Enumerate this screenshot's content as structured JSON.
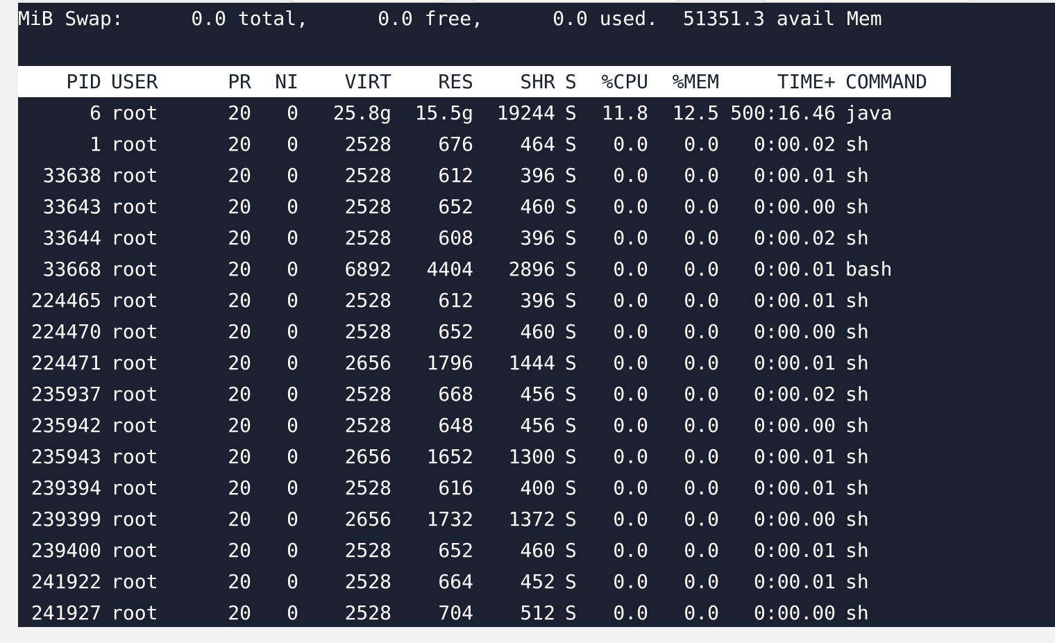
{
  "swap": {
    "label": "MiB Swap:",
    "total": "0.0 total,",
    "free": "0.0 free,",
    "used": "0.0 used.",
    "avail": "51351.3 avail Mem"
  },
  "table": {
    "columns": [
      "PID",
      "USER",
      "PR",
      "NI",
      "VIRT",
      "RES",
      "SHR",
      "S",
      "%CPU",
      "%MEM",
      "TIME+",
      "COMMAND"
    ],
    "rows": [
      [
        "6",
        "root",
        "20",
        "0",
        "25.8g",
        "15.5g",
        "19244",
        "S",
        "11.8",
        "12.5",
        "500:16.46",
        "java"
      ],
      [
        "1",
        "root",
        "20",
        "0",
        "2528",
        "676",
        "464",
        "S",
        "0.0",
        "0.0",
        "0:00.02",
        "sh"
      ],
      [
        "33638",
        "root",
        "20",
        "0",
        "2528",
        "612",
        "396",
        "S",
        "0.0",
        "0.0",
        "0:00.01",
        "sh"
      ],
      [
        "33643",
        "root",
        "20",
        "0",
        "2528",
        "652",
        "460",
        "S",
        "0.0",
        "0.0",
        "0:00.00",
        "sh"
      ],
      [
        "33644",
        "root",
        "20",
        "0",
        "2528",
        "608",
        "396",
        "S",
        "0.0",
        "0.0",
        "0:00.02",
        "sh"
      ],
      [
        "33668",
        "root",
        "20",
        "0",
        "6892",
        "4404",
        "2896",
        "S",
        "0.0",
        "0.0",
        "0:00.01",
        "bash"
      ],
      [
        "224465",
        "root",
        "20",
        "0",
        "2528",
        "612",
        "396",
        "S",
        "0.0",
        "0.0",
        "0:00.01",
        "sh"
      ],
      [
        "224470",
        "root",
        "20",
        "0",
        "2528",
        "652",
        "460",
        "S",
        "0.0",
        "0.0",
        "0:00.00",
        "sh"
      ],
      [
        "224471",
        "root",
        "20",
        "0",
        "2656",
        "1796",
        "1444",
        "S",
        "0.0",
        "0.0",
        "0:00.01",
        "sh"
      ],
      [
        "235937",
        "root",
        "20",
        "0",
        "2528",
        "668",
        "456",
        "S",
        "0.0",
        "0.0",
        "0:00.02",
        "sh"
      ],
      [
        "235942",
        "root",
        "20",
        "0",
        "2528",
        "648",
        "456",
        "S",
        "0.0",
        "0.0",
        "0:00.00",
        "sh"
      ],
      [
        "235943",
        "root",
        "20",
        "0",
        "2656",
        "1652",
        "1300",
        "S",
        "0.0",
        "0.0",
        "0:00.01",
        "sh"
      ],
      [
        "239394",
        "root",
        "20",
        "0",
        "2528",
        "616",
        "400",
        "S",
        "0.0",
        "0.0",
        "0:00.01",
        "sh"
      ],
      [
        "239399",
        "root",
        "20",
        "0",
        "2656",
        "1732",
        "1372",
        "S",
        "0.0",
        "0.0",
        "0:00.00",
        "sh"
      ],
      [
        "239400",
        "root",
        "20",
        "0",
        "2528",
        "652",
        "460",
        "S",
        "0.0",
        "0.0",
        "0:00.01",
        "sh"
      ],
      [
        "241922",
        "root",
        "20",
        "0",
        "2528",
        "664",
        "452",
        "S",
        "0.0",
        "0.0",
        "0:00.01",
        "sh"
      ],
      [
        "241927",
        "root",
        "20",
        "0",
        "2528",
        "704",
        "512",
        "S",
        "0.0",
        "0.0",
        "0:00.00",
        "sh"
      ]
    ]
  },
  "colors": {
    "terminal_bg": "#1b2130",
    "terminal_fg": "#ffffff",
    "header_bg": "#ffffff",
    "header_fg": "#1b2130",
    "page_bg": "#f2f2f3"
  }
}
